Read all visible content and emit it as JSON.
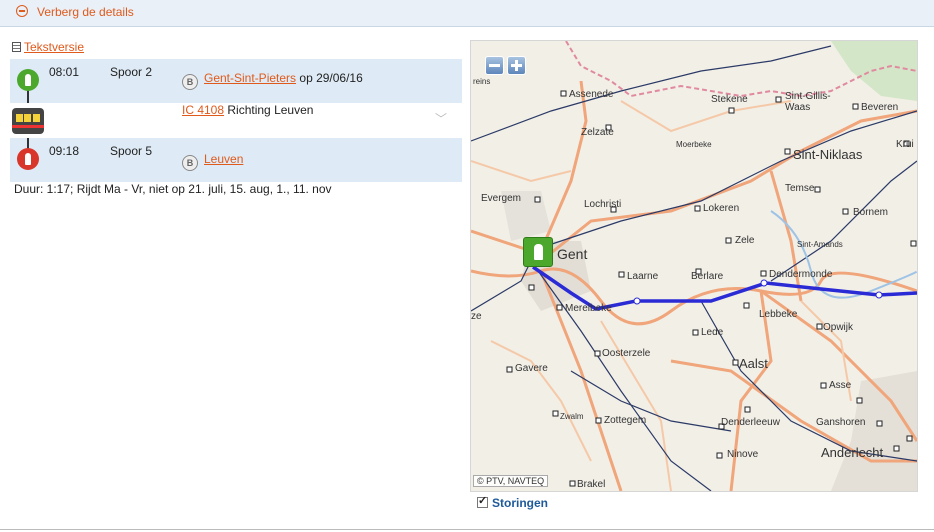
{
  "header": {
    "toggle_label": "Verberg de details"
  },
  "text_version": {
    "label": "Tekstversie"
  },
  "departure": {
    "time": "08:01",
    "platform": "Spoor 2",
    "station": "Gent-Sint-Pieters",
    "date_suffix": "op 29/06/16",
    "operator_logo": "B"
  },
  "train": {
    "number": "IC 4108",
    "direction": "Richting Leuven"
  },
  "arrival": {
    "time": "09:18",
    "platform": "Spoor 5",
    "station": "Leuven",
    "operator_logo": "B"
  },
  "duration": "Duur: 1:17; Rijdt Ma - Vr, niet op 21. juli, 15. aug, 1., 11. nov",
  "map": {
    "copyright": "© PTV, NAVTEQ",
    "labels": {
      "assenede": "Assenede",
      "stekene": "Stekene",
      "sgw": "Sint-Gillis-",
      "waas": "Waas",
      "beveren": "Beveren",
      "zelzate": "Zelzate",
      "moerbeke": "Moerbeke",
      "sintniklaas": "Sint-Niklaas",
      "kruis": "Krui",
      "temse": "Temse",
      "evergem": "Evergem",
      "lochristi": "Lochristi",
      "lokeren": "Lokeren",
      "bornem": "Bornem",
      "zele": "Zele",
      "sintamands": "Sint-Amands",
      "gent": "Gent",
      "laarne": "Laarne",
      "berlare": "Berlare",
      "dendermonde": "Dendermonde",
      "merelbeke": "Merelbeke",
      "lebbeke": "Lebbeke",
      "opwijk": "Opwijk",
      "lede": "Lede",
      "oosterzele": "Oosterzele",
      "aalst": "Aalst",
      "gavere": "Gavere",
      "asse": "Asse",
      "zwalm": "Zwalm",
      "zottegem": "Zottegem",
      "denderleeuw": "Denderleeuw",
      "ganshoren": "Ganshoren",
      "ninove": "Ninove",
      "anderlecht": "Anderlecht",
      "brakel": "Brakel",
      "reins": "reins",
      "ze": "ze"
    }
  },
  "storingen": {
    "label": "Storingen",
    "checked": true
  }
}
